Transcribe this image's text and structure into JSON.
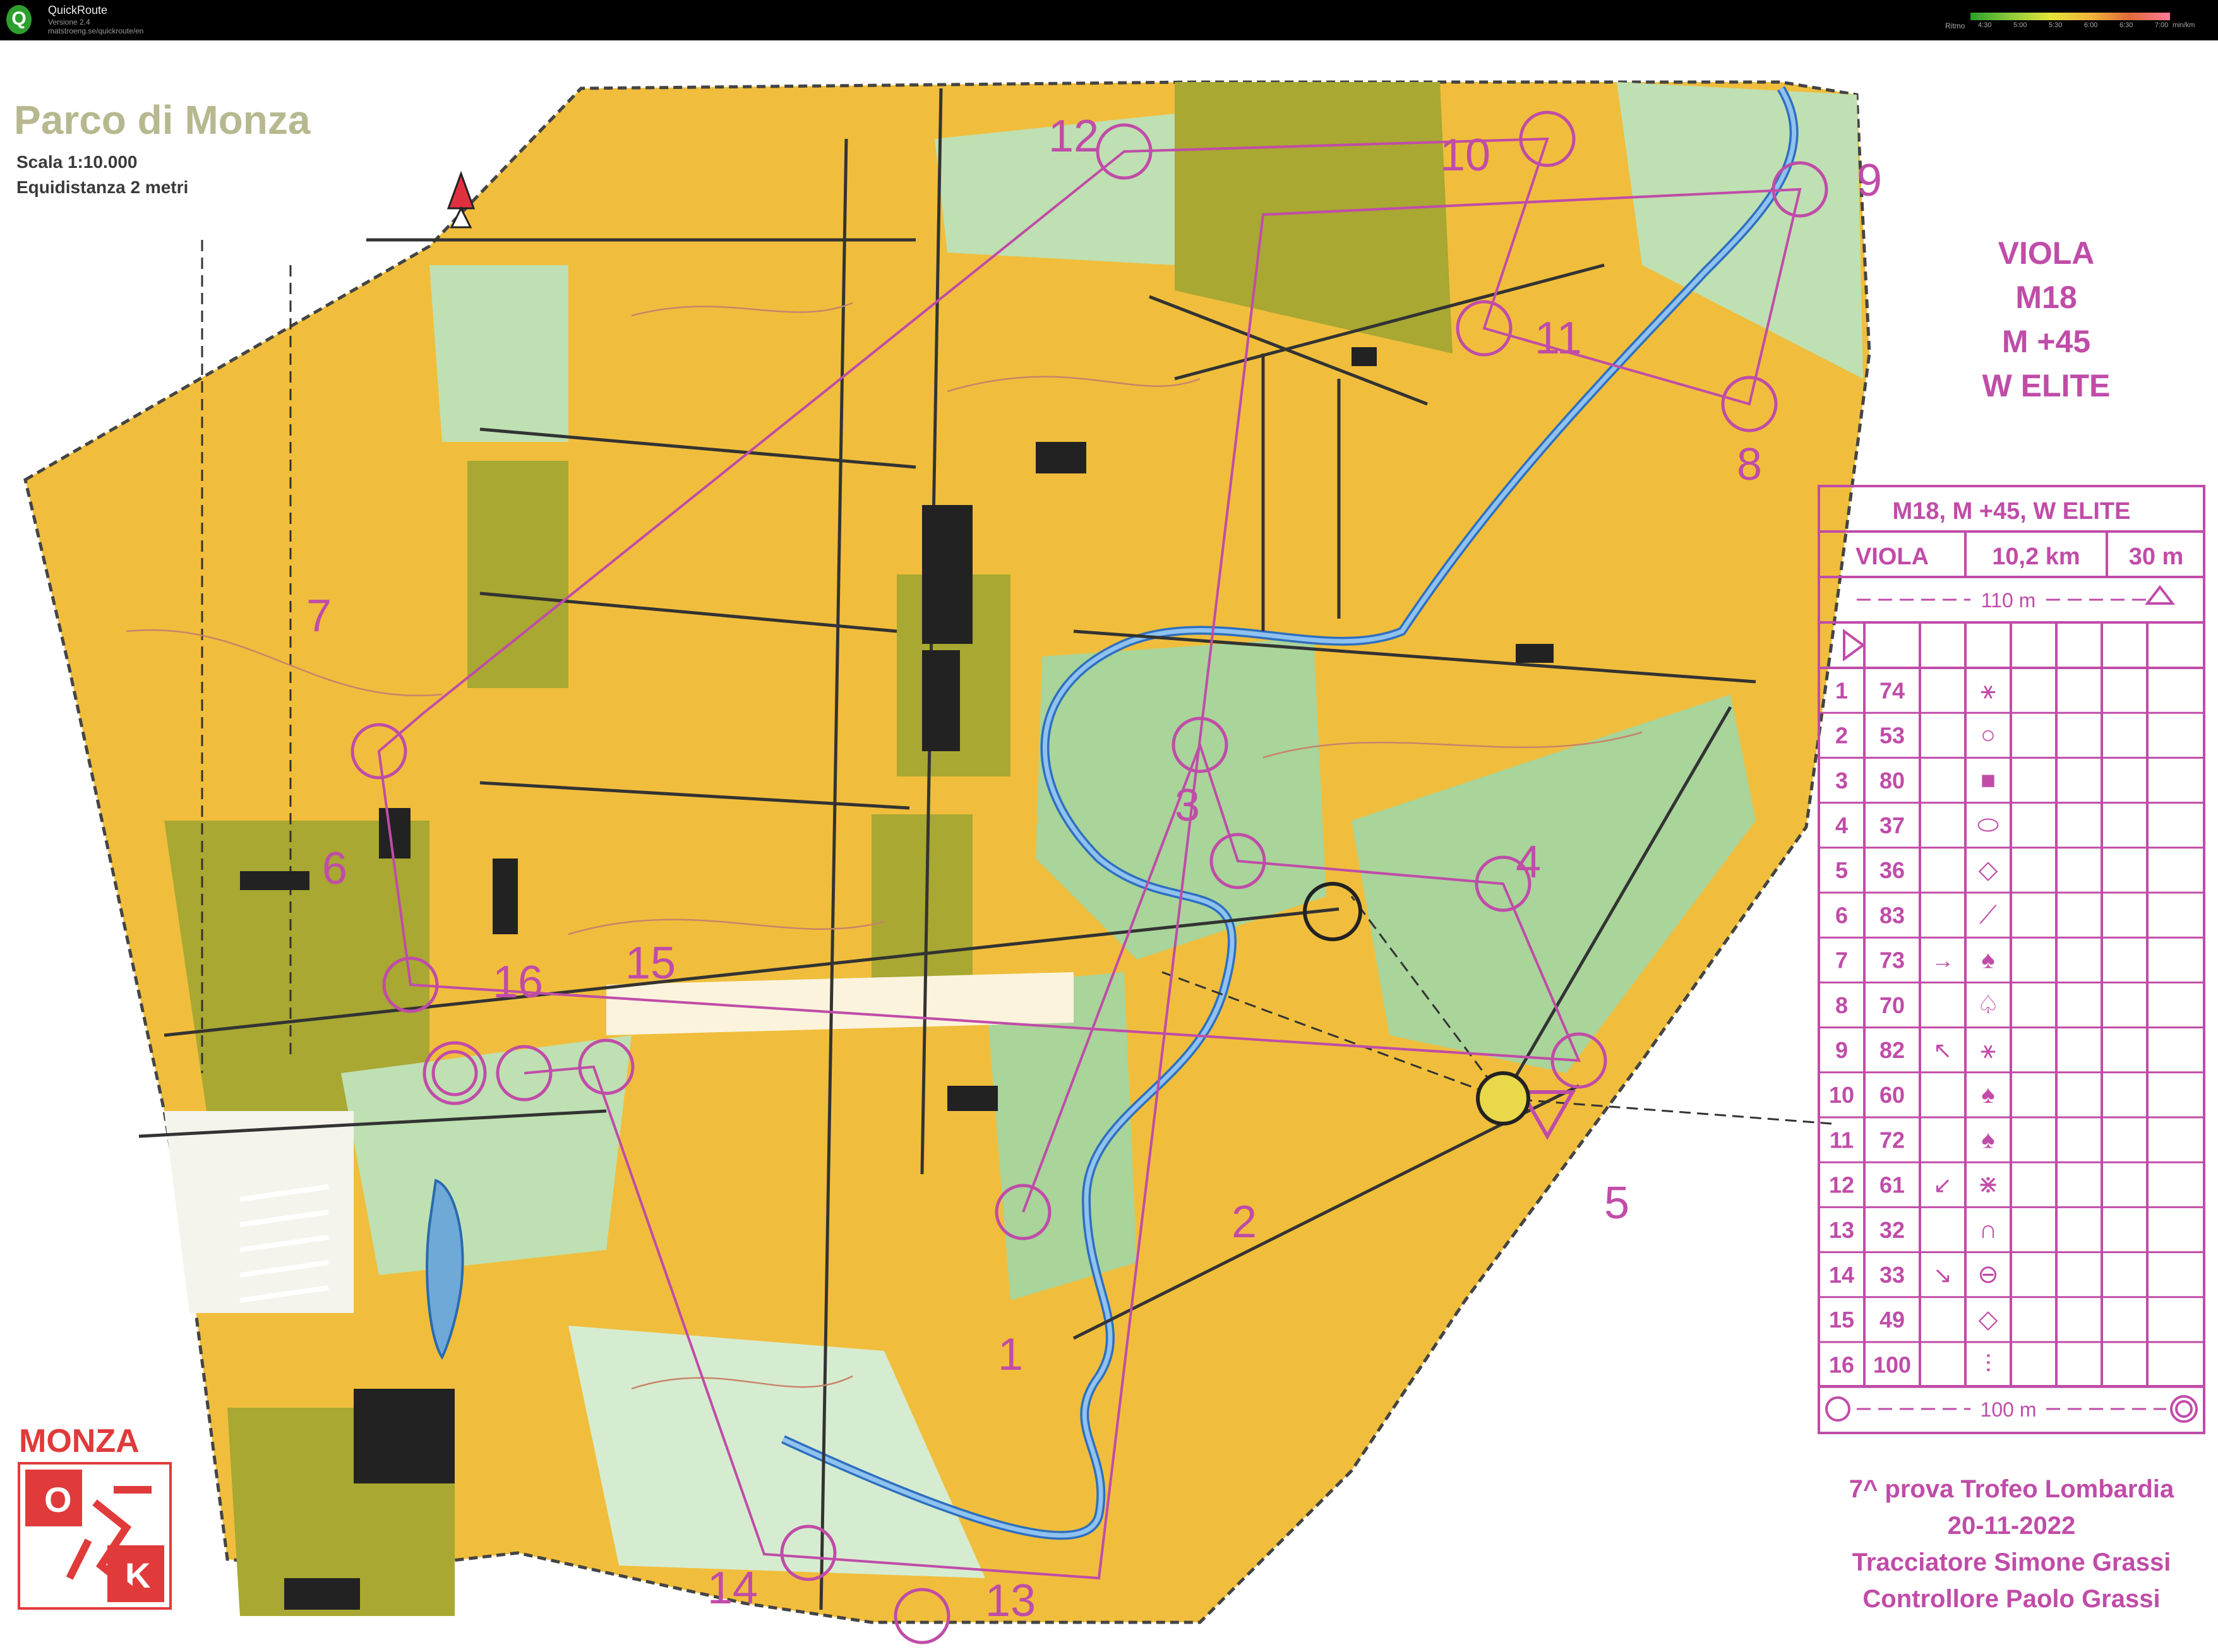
{
  "app": {
    "icon_letter": "Q",
    "name": "QuickRoute",
    "version": "Versione 2.4",
    "url": "matstroeng.se/quickroute/en",
    "legend": {
      "label": "Ritmo",
      "ticks": [
        "4:30",
        "5:00",
        "5:30",
        "6:00",
        "6:30",
        "7:00"
      ],
      "unit": "min/km"
    }
  },
  "map": {
    "title": "Parco di Monza",
    "scale": "Scala 1:10.000",
    "contour": "Equidistanza  2 metri",
    "course_lines": [
      "VIOLA",
      "M18",
      "M +45",
      "W ELITE"
    ],
    "control_labels": [
      "1",
      "2",
      "3",
      "4",
      "5",
      "6",
      "7",
      "8",
      "9",
      "10",
      "11",
      "12",
      "13",
      "14",
      "15",
      "16"
    ],
    "club_name": "MONZA",
    "club_logo_letters": [
      "O",
      "K"
    ],
    "event": {
      "line1": "7^ prova Trofeo Lombardia",
      "date": "20-11-2022",
      "planner": "Tracciatore Simone Grassi",
      "controller": "Controllore Paolo Grassi"
    }
  },
  "description_sheet": {
    "header": "M18, M +45, W ELITE",
    "course": "VIOLA",
    "length": "10,2 km",
    "climb": "30 m",
    "start_line": "110 m",
    "finish_line": "100 m",
    "rows": [
      {
        "n": "1",
        "code": "74",
        "dir": "",
        "sym": "⚹"
      },
      {
        "n": "2",
        "code": "53",
        "dir": "",
        "sym": "○"
      },
      {
        "n": "3",
        "code": "80",
        "dir": "",
        "sym": "■"
      },
      {
        "n": "4",
        "code": "37",
        "dir": "",
        "sym": "⬭"
      },
      {
        "n": "5",
        "code": "36",
        "dir": "",
        "sym": "◇"
      },
      {
        "n": "6",
        "code": "83",
        "dir": "",
        "sym": "⟋"
      },
      {
        "n": "7",
        "code": "73",
        "dir": "→",
        "sym": "♠"
      },
      {
        "n": "8",
        "code": "70",
        "dir": "",
        "sym": "♤"
      },
      {
        "n": "9",
        "code": "82",
        "dir": "↖",
        "sym": "⚹"
      },
      {
        "n": "10",
        "code": "60",
        "dir": "",
        "sym": "♠"
      },
      {
        "n": "11",
        "code": "72",
        "dir": "",
        "sym": "♠"
      },
      {
        "n": "12",
        "code": "61",
        "dir": "↙",
        "sym": "⋇"
      },
      {
        "n": "13",
        "code": "32",
        "dir": "",
        "sym": "∩"
      },
      {
        "n": "14",
        "code": "33",
        "dir": "↘",
        "sym": "⊖"
      },
      {
        "n": "15",
        "code": "49",
        "dir": "",
        "sym": "◇"
      },
      {
        "n": "16",
        "code": "100",
        "dir": "",
        "sym": "⫶"
      }
    ]
  }
}
